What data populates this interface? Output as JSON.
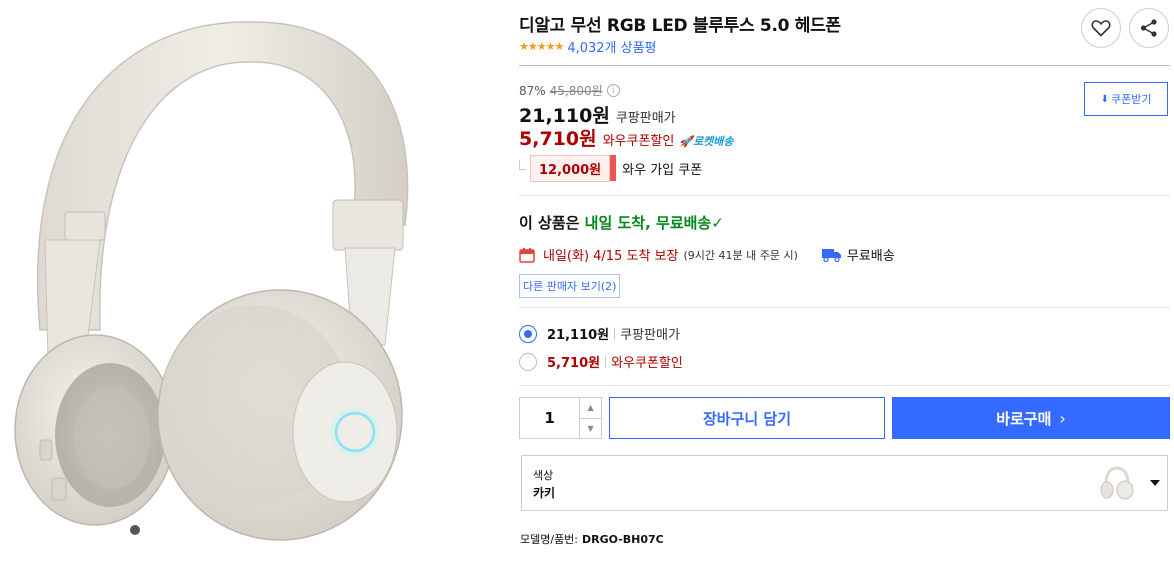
{
  "product": {
    "title": "디알고 무선 RGB LED 블루투스 5.0 헤드폰",
    "stars": "★★★★★",
    "review_count": "4,032개 상품평"
  },
  "pricing": {
    "discount_rate": "87%",
    "original_price": "45,800원",
    "sale_price": "21,110원",
    "sale_label": "쿠팡판매가",
    "wow_price": "5,710원",
    "wow_label": "와우쿠폰할인",
    "rocket_badge": "로켓배송",
    "coupon_amount": "12,000원",
    "coupon_desc": "와우 가입 쿠폰",
    "coupon_button": "쿠폰받기"
  },
  "delivery": {
    "head_prefix": "이 상품은",
    "head_highlight": "내일 도착, 무료배송",
    "check": "✓",
    "arrival": "내일(화) 4/15 도착 보장",
    "arrival_sub": "(9시간 41분 내 주문 시)",
    "free_shipping": "무료배송",
    "other_sellers": "다른 판매자 보기(2)"
  },
  "options": [
    {
      "price": "21,110원",
      "label": "쿠팡판매가",
      "selected": true
    },
    {
      "price": "5,710원",
      "label": "와우쿠폰할인",
      "selected": false
    }
  ],
  "purchase": {
    "quantity": "1",
    "qty_up": "▲",
    "qty_down": "▼",
    "cart_button": "장바구니 담기",
    "buy_button": "바로구매",
    "buy_chevron": "›"
  },
  "color_select": {
    "label": "색상",
    "value": "카키"
  },
  "model": {
    "label": "모델명/품번:",
    "value": "DRGO-BH07C"
  },
  "icons": {
    "heart": "heart-icon",
    "share": "share-icon",
    "calendar": "calendar-icon",
    "truck": "truck-icon",
    "download": "download-icon",
    "info": "info-icon"
  },
  "colors": {
    "accent_blue": "#346aff",
    "wow_red": "#ae0000",
    "delivery_green": "#00891a",
    "star_orange": "#f39c12"
  }
}
